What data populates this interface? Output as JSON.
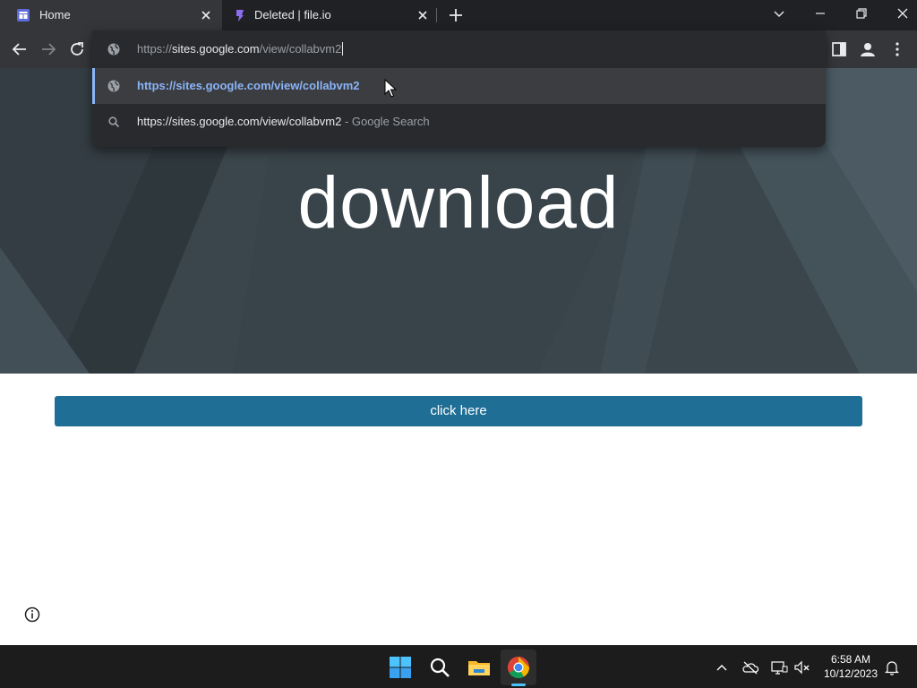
{
  "tabs": [
    {
      "title": "Home",
      "favicon": "sites-icon",
      "active": true
    },
    {
      "title": "Deleted | file.io",
      "favicon": "fileio-icon",
      "active": false
    }
  ],
  "omnibox": {
    "text_prefix": "https://",
    "text_host": "sites.google.com",
    "text_path": "/view/collabvm2",
    "suggestions": [
      {
        "text": "https://sites.google.com/view/collabvm2",
        "icon": "globe-icon"
      },
      {
        "text": "https://sites.google.com/view/collabvm2",
        "suffix": " - Google Search",
        "icon": "search-icon"
      }
    ]
  },
  "page": {
    "hero_title": "download",
    "button_label": "click here"
  },
  "taskbar": {
    "time": "6:58 AM",
    "date": "10/12/2023"
  },
  "colors": {
    "hero_bg": "#3b464d",
    "button": "#1f6e96",
    "suggestion_accent": "#8ab4f8"
  }
}
